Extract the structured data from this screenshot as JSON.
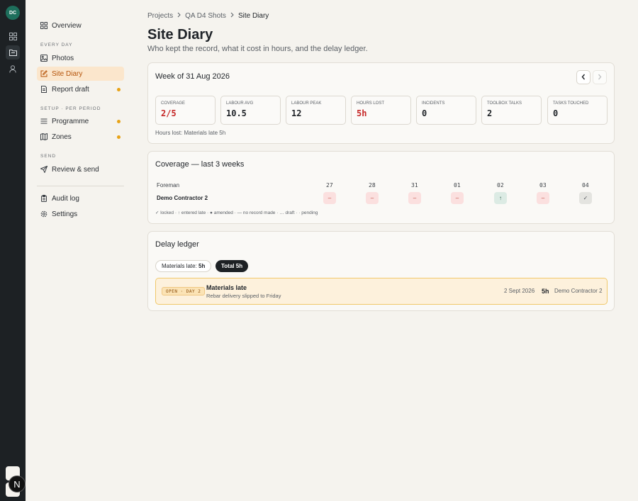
{
  "rail": {
    "avatar": "DC",
    "icons": [
      "grid-icon",
      "folder-icon",
      "user-icon"
    ],
    "bottom_badge": "N"
  },
  "sidebar": {
    "overview": "Overview",
    "section_every_day": "EVERY DAY",
    "photos": "Photos",
    "site_diary": "Site Diary",
    "report_draft": "Report draft",
    "section_setup": "SETUP · PER PERIOD",
    "programme": "Programme",
    "zones": "Zones",
    "section_send": "SEND",
    "review_send": "Review & send",
    "audit_log": "Audit log",
    "settings": "Settings"
  },
  "breadcrumb": [
    "Projects",
    "QA D4 Shots",
    "Site Diary"
  ],
  "page": {
    "title": "Site Diary",
    "subtitle": "Who kept the record, what it cost in hours, and the delay ledger."
  },
  "week_card": {
    "title": "Week of 31 Aug 2026",
    "stats": [
      {
        "label": "COVERAGE",
        "value": "2/5",
        "alert": true
      },
      {
        "label": "LABOUR AVG",
        "value": "10.5",
        "alert": false
      },
      {
        "label": "LABOUR PEAK",
        "value": "12",
        "alert": false
      },
      {
        "label": "HOURS LOST",
        "value": "5h",
        "alert": true
      },
      {
        "label": "INCIDENTS",
        "value": "0",
        "alert": false
      },
      {
        "label": "TOOLBOX TALKS",
        "value": "2",
        "alert": false
      },
      {
        "label": "TASKS TOUCHED",
        "value": "0",
        "alert": false
      }
    ],
    "hours_note": "Hours lost: Materials late 5h"
  },
  "coverage_card": {
    "title": "Coverage — last 3 weeks",
    "role_header": "Foreman",
    "days": [
      "27",
      "28",
      "31",
      "01",
      "02",
      "03",
      "04"
    ],
    "row_name": "Demo Contractor 2",
    "cells": [
      "–",
      "–",
      "–",
      "–",
      "↑",
      "–",
      "✓"
    ],
    "legend": "✓ locked · ↑ entered late · ● amended · — no record made · … draft · · pending"
  },
  "delay_card": {
    "title": "Delay ledger",
    "filter_prefix": "Materials late: ",
    "filter_value": "5h",
    "total": "Total 5h",
    "entry": {
      "badge": "OPEN · DAY 2",
      "title": "Materials late",
      "note": "Rebar delivery slipped to Friday",
      "date": "2 Sept 2026",
      "hours": "5h",
      "who": "Demo Contractor 2"
    }
  },
  "colors": {
    "accent": "#e8a317",
    "alert": "#c62828",
    "rail": "#1d2124",
    "avatar": "#1e6f5c"
  }
}
